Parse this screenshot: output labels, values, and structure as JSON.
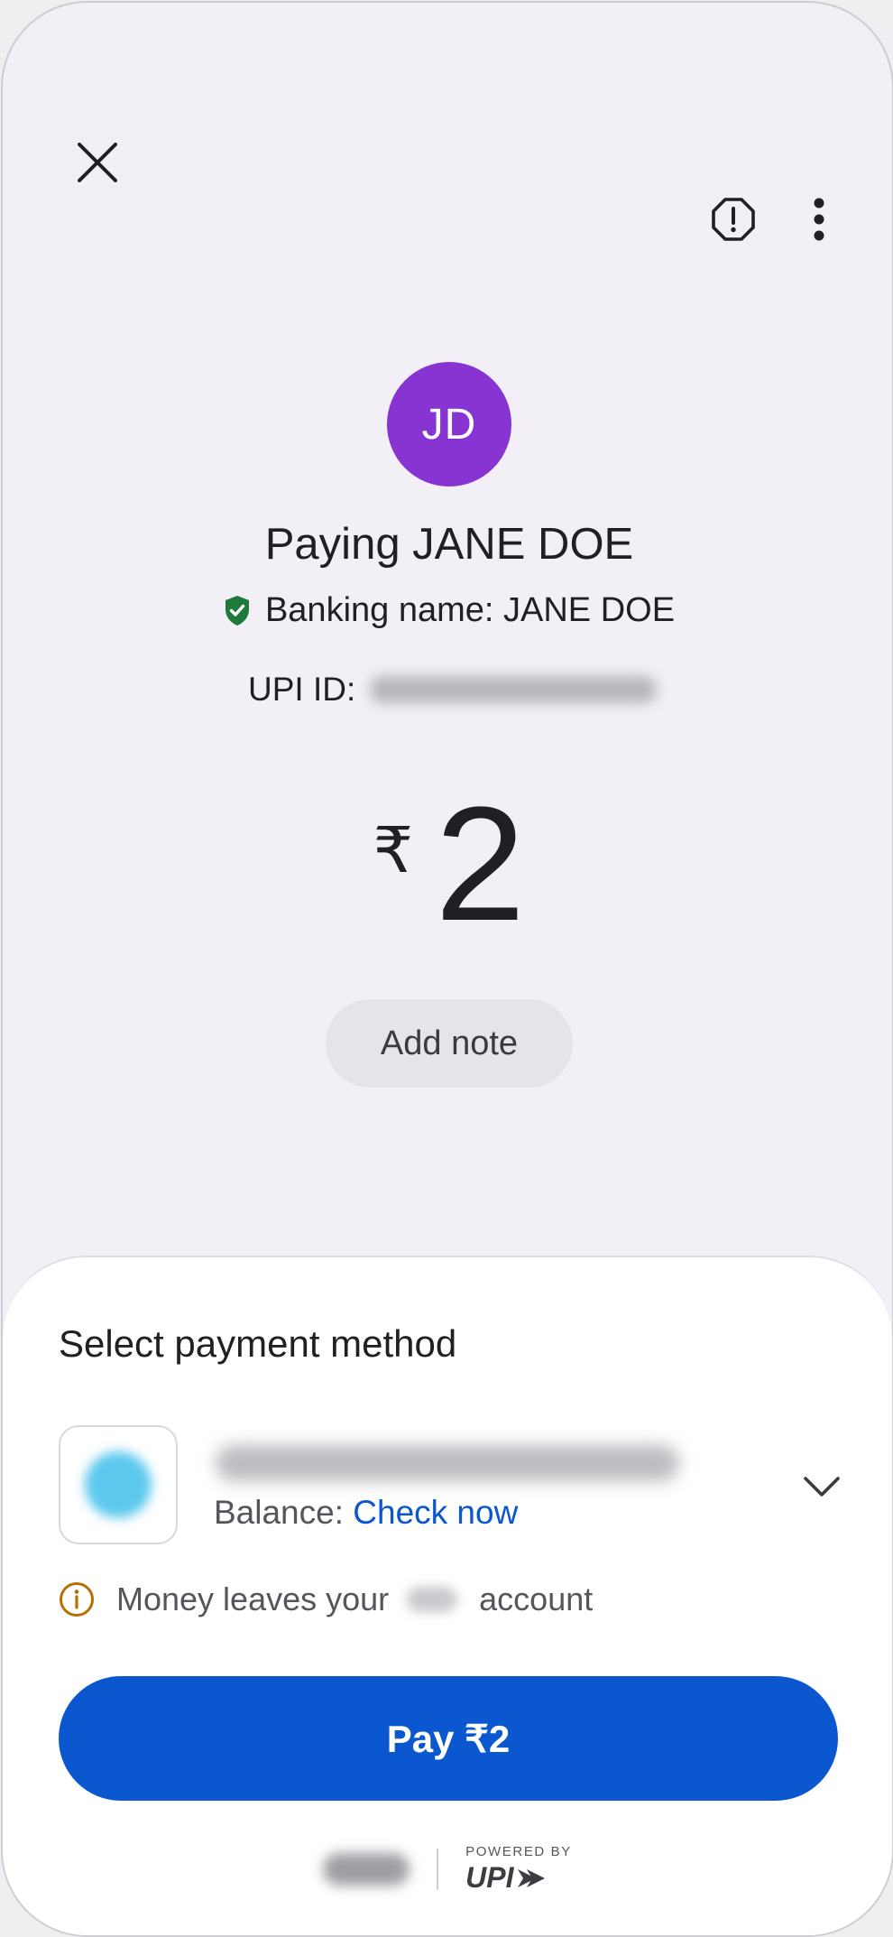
{
  "header": {
    "close_icon": "close-icon",
    "report_icon": "report-icon",
    "more_icon": "more-vert-icon"
  },
  "payee": {
    "initials": "JD",
    "avatar_color": "#8734d3",
    "paying_label": "Paying JANE DOE",
    "banking_name_label": "Banking name: JANE DOE",
    "verified_icon": "verified-shield-icon",
    "upi_id_label": "UPI ID:"
  },
  "amount": {
    "currency_symbol": "₹",
    "value": "2"
  },
  "add_note_label": "Add note",
  "payment_sheet": {
    "title": "Select payment method",
    "balance_label": "Balance:",
    "check_now_label": "Check now",
    "info_text_before": "Money leaves your",
    "info_text_after": "account",
    "pay_button_label": "Pay ₹2",
    "powered_by_label": "POWERED BY",
    "upi_brand": "UPI",
    "accent_color": "#0b57d0"
  }
}
